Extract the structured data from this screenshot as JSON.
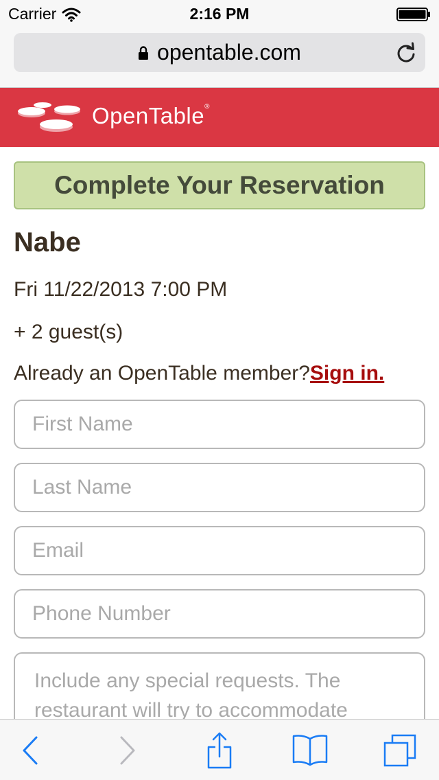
{
  "status_bar": {
    "carrier": "Carrier",
    "time": "2:16 PM"
  },
  "browser": {
    "url": "opentable.com"
  },
  "brand": {
    "name": "OpenTable",
    "trademark": "®",
    "header_color": "#da3743"
  },
  "reservation": {
    "banner_title": "Complete Your Reservation",
    "restaurant": "Nabe",
    "datetime": "Fri 11/22/2013 7:00 PM",
    "guests": "+ 2 guest(s)",
    "member_prompt": "Already an OpenTable member?",
    "signin_label": "Sign in."
  },
  "form": {
    "first_name_placeholder": "First Name",
    "last_name_placeholder": "Last Name",
    "email_placeholder": "Email",
    "phone_placeholder": "Phone Number",
    "requests_placeholder": "Include any special requests. The restaurant will try to accommodate"
  },
  "toolbar": {
    "icons": [
      "back-icon",
      "forward-icon",
      "share-icon",
      "bookmarks-icon",
      "tabs-icon"
    ],
    "accent": "#1a7cf5"
  }
}
